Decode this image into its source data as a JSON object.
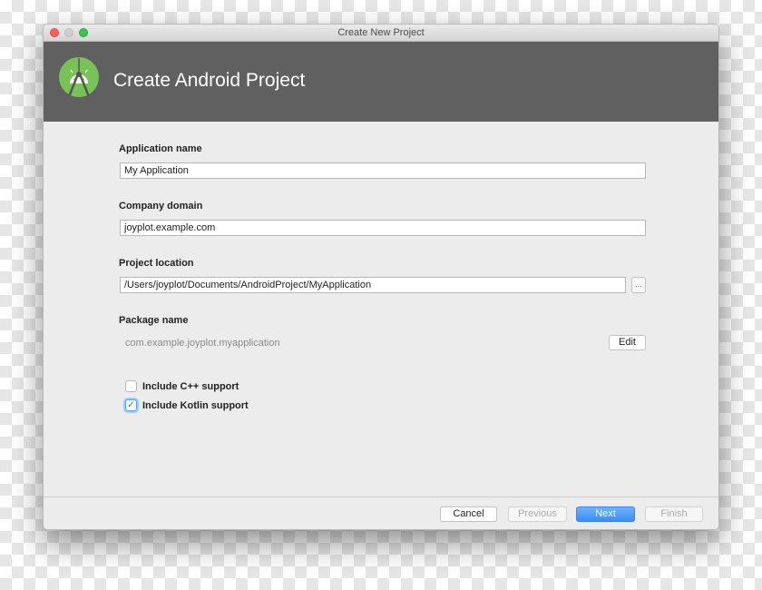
{
  "window": {
    "title": "Create New Project"
  },
  "header": {
    "title": "Create Android Project",
    "logo_icon": "android-studio-icon",
    "bg_color": "#606060",
    "logo_color": "#78c257"
  },
  "form": {
    "app_name": {
      "label": "Application name",
      "value": "My Application"
    },
    "company_domain": {
      "label": "Company domain",
      "value": "joyplot.example.com"
    },
    "project_location": {
      "label": "Project location",
      "value": "/Users/joyplot/Documents/AndroidProject/MyApplication",
      "browse_label": "..."
    },
    "package_name": {
      "label": "Package name",
      "value": "com.example.joyplot.myapplication",
      "edit_label": "Edit"
    },
    "include_cpp": {
      "label": "Include C++ support",
      "checked": false
    },
    "include_kotlin": {
      "label": "Include Kotlin support",
      "checked": true,
      "check_mark": "✓"
    }
  },
  "footer": {
    "cancel": "Cancel",
    "previous": "Previous",
    "next": "Next",
    "finish": "Finish",
    "accent_color": "#3a8ef6"
  }
}
